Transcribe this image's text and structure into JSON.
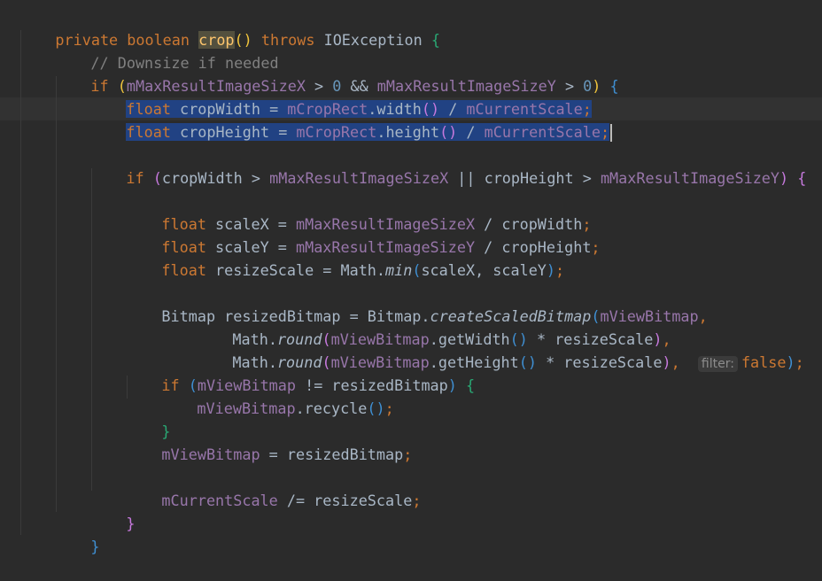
{
  "editor": {
    "line_crop_sig": {
      "private": "private",
      "boolean": "boolean",
      "crop": "crop",
      "throws": "throws",
      "exception": "IOException"
    },
    "comment": "// Downsize if needed",
    "if1": {
      "if": "if",
      "field_x": "mMaxResultImageSizeX",
      "gt0a": " > ",
      "zero_a": "0",
      "and": " && ",
      "field_y": "mMaxResultImageSizeY",
      "gt0b": " > ",
      "zero_b": "0"
    },
    "line_cropWidth": {
      "float": "float",
      "var": " cropWidth = ",
      "rect": "mCropRect",
      "method": "width",
      "div": " / ",
      "scale": "mCurrentScale"
    },
    "line_cropHeight": {
      "float": "float",
      "var": " cropHeight = ",
      "rect": "mCropRect",
      "method": "height",
      "div": " / ",
      "scale": "mCurrentScale"
    },
    "if2": {
      "if": "if",
      "cw": "cropWidth > ",
      "fx": "mMaxResultImageSizeX",
      "or": " || cropHeight > ",
      "fy": "mMaxResultImageSizeY"
    },
    "scaleX": {
      "float": "float",
      "lhs": " scaleX = ",
      "field": "mMaxResultImageSizeX",
      "rhs": " / cropWidth"
    },
    "scaleY": {
      "float": "float",
      "lhs": " scaleY = ",
      "field": "mMaxResultImageSizeY",
      "rhs": " / cropHeight"
    },
    "resize": {
      "float": "float",
      "lhs": " resizeScale = Math.",
      "min": "min",
      "args": "scaleX, scaleY"
    },
    "bitmap": {
      "lhs": "Bitmap resizedBitmap = Bitmap.",
      "method": "createScaledBitmap",
      "arg": "mViewBitmap"
    },
    "round1": {
      "math": "Math.",
      "round": "round",
      "field": "mViewBitmap",
      "getter": ".getWidth",
      "rest": " * resizeScale"
    },
    "round2": {
      "math": "Math.",
      "round": "round",
      "field": "mViewBitmap",
      "getter": ".getHeight",
      "rest": " * resizeScale",
      "hint": "filter:",
      "false": "false"
    },
    "if3": {
      "if": "if",
      "field": "mViewBitmap",
      "rest": " != resizedBitmap"
    },
    "recycle": {
      "field": "mViewBitmap",
      "call": ".recycle"
    },
    "assign": {
      "field": "mViewBitmap",
      "rest": " = resizedBitmap"
    },
    "scaleDiv": {
      "field": "mCurrentScale",
      "rest": " /= resizeScale"
    }
  }
}
